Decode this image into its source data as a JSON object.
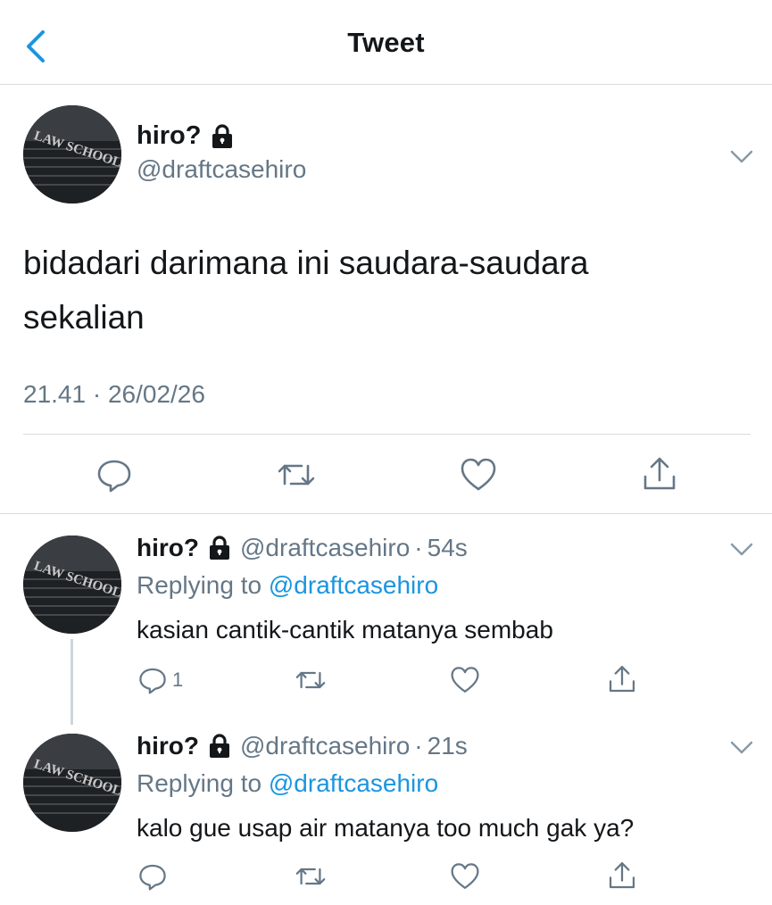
{
  "header": {
    "title": "Tweet"
  },
  "main_tweet": {
    "name": "hiro?",
    "handle": "@draftcasehiro",
    "text_line1": "bidadari darimana ini saudara-saudara",
    "text_line2": "sekalian",
    "timestamp": "21.41 · 26/02/26",
    "avatar_text": "LAW SCHOOL"
  },
  "replies": [
    {
      "name": "hiro?",
      "handle": "@draftcasehiro",
      "dot": "·",
      "time": "54s",
      "replying_prefix": "Replying to",
      "replying_to": "@draftcasehiro",
      "text": "kasian cantik-cantik matanya sembab",
      "reply_count": "1",
      "avatar_text": "LAW SCHOOL"
    },
    {
      "name": "hiro?",
      "handle": "@draftcasehiro",
      "dot": "·",
      "time": "21s",
      "replying_prefix": "Replying to",
      "replying_to": "@draftcasehiro",
      "text": "kalo gue usap air matanya too much gak ya?",
      "reply_count": "",
      "avatar_text": "LAW SCHOOL"
    }
  ],
  "icons": [
    "back-chevron-icon",
    "lock-icon",
    "chevron-down-icon",
    "reply-icon",
    "retweet-icon",
    "like-icon",
    "share-icon"
  ],
  "colors": {
    "accent": "#1b95e0",
    "muted": "#657786",
    "text": "#14171a",
    "divider": "#d6dbdf"
  }
}
